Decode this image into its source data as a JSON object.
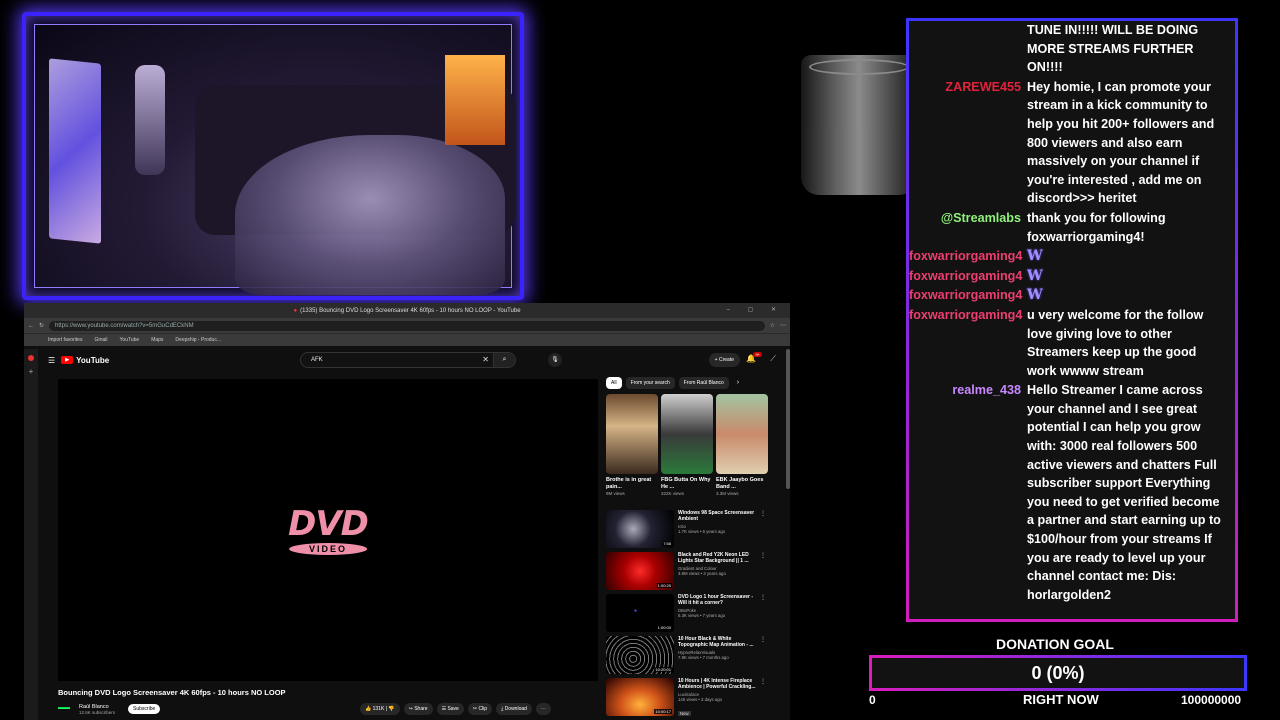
{
  "browser": {
    "window_title": "(1335) Bouncing DVD Logo Screensaver 4K 60fps - 10 hours NO LOOP - YouTube",
    "url": "https://www.youtube.com/watch?v=5mGuCdECkNM",
    "bookmarks": [
      "Import favorites",
      "Gmail",
      "YouTube",
      "Maps",
      "Deepship - Produc..."
    ]
  },
  "youtube": {
    "logo_text": "YouTube",
    "search_value": "AFK",
    "create_label": "Create",
    "notif_count": "9+",
    "player_logo": {
      "top": "DVD",
      "bottom": "VIDEO"
    },
    "video_title": "Bouncing DVD Logo Screensaver 4K 60fps - 10 hours NO LOOP",
    "channel_name": "Raúl Blanco",
    "channel_subs": "12.6K subscribers",
    "subscribe_label": "Subscribe",
    "actions": {
      "likes": "131K",
      "share": "Share",
      "save": "Save",
      "clip": "Clip",
      "download": "Download"
    },
    "chips": [
      "All",
      "From your search",
      "From Raúl Blanco"
    ],
    "shorts": [
      {
        "title": "Brothe is in great pain...",
        "views": "9M views"
      },
      {
        "title": "FBG Butta On Why He ...",
        "views": "322K views"
      },
      {
        "title": "EBK Jaaybo Goes Band ...",
        "views": "3.3M views"
      }
    ],
    "recommendations": [
      {
        "title": "Windows 98 Space Screensaver Ambient",
        "channel": "Ictio",
        "meta": "1.7K views • 6 years ago",
        "duration": "7:58"
      },
      {
        "title": "Black and Red Y2K Neon LED Lights Star Background || 1 ...",
        "channel": "Gradient and Colour",
        "meta": "3.8M views • 3 years ago",
        "duration": "1:00:25"
      },
      {
        "title": "DVD Logo 1 hour Screensaver - Will it hit a corner?",
        "channel": "DBoPoke",
        "meta": "5.3K views • 7 years ago",
        "duration": "1:00:00"
      },
      {
        "title": "10 Hour Black & White Topographic Map Animation - ...",
        "channel": "HypnoRelaxVisuals",
        "meta": "7.8K views • 7 months ago",
        "duration": "10:20:01"
      },
      {
        "title": "10 Hours | 4K Intense Fireplace Ambience | Powerful Crackling...",
        "channel": "LuxiSolace",
        "meta": "145 views • 3 days ago",
        "duration": "10:00:17",
        "badge": "New"
      }
    ]
  },
  "chat": {
    "messages": [
      {
        "name": "",
        "text": "TUNE IN!!!!! WILL BE DOING MORE STREAMS FURTHER ON!!!!",
        "color": "#ffffff"
      },
      {
        "name": "ZAREWE455",
        "text": "Hey homie, I can promote your stream in a kick community to help you hit 200+ followers and 800 viewers and also earn massively on your channel if you're interested , add me on discord>>> heritet",
        "color": "#e0233a"
      },
      {
        "name": "@Streamlabs",
        "text": "thank you for following foxwarriorgaming4!",
        "color": "#8ff27a"
      },
      {
        "name": "foxwarriorgaming4",
        "text": "",
        "color": "#ee3e6f",
        "badge": "W"
      },
      {
        "name": "foxwarriorgaming4",
        "text": "",
        "color": "#ee3e6f",
        "badge": "W"
      },
      {
        "name": "foxwarriorgaming4",
        "text": "",
        "color": "#ee3e6f",
        "badge": "W"
      },
      {
        "name": "foxwarriorgaming4",
        "text": "u very welcome for the follow love giving love to other Streamers keep up the good work wwww stream",
        "color": "#ee3e6f"
      },
      {
        "name": "realme_438",
        "text": "Hello Streamer I came across your channel and I see great potential I can help you grow with: 3000 real followers 500 active viewers and chatters Full subscriber support Everything you need to get verified become a partner and start earning up to $100/hour from your streams If you are ready to level up your channel contact me: Dis: horlargolden2",
        "color": "#c888ff"
      }
    ]
  },
  "donation": {
    "title": "DONATION GOAL",
    "value_text": "0 (0%)",
    "progress": 0,
    "min_label": "0",
    "now_label": "RIGHT NOW",
    "max_label": "100000000"
  },
  "colors": {
    "chat_border_top": "#3d36ff",
    "chat_border_bottom": "#d11dbd",
    "cam_border": "#3b23ff",
    "dvd_pink": "#f08fa8"
  }
}
